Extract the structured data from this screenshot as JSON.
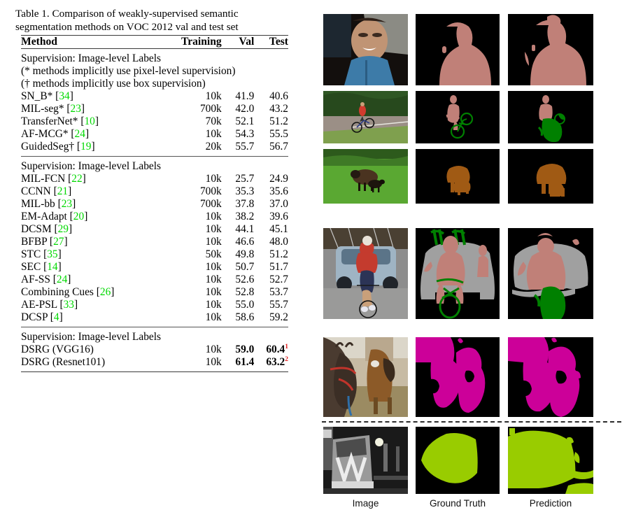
{
  "table": {
    "caption": "Table 1. Comparison of weakly-supervised semantic segmentation methods on VOC 2012 val and test set",
    "headers": {
      "method": "Method",
      "training": "Training",
      "val": "Val",
      "test": "Test"
    },
    "blocks": [
      {
        "group_label": "Supervision: Image-level Labels",
        "notes": [
          "(* methods implicitly use pixel-level supervision)",
          "(† methods implicitly use box supervision)"
        ],
        "rows": [
          {
            "method": "SN_B* [",
            "cite": "34",
            "close": "]",
            "training": "10k",
            "val": "41.9",
            "test": "40.6"
          },
          {
            "method": "MIL-seg* [",
            "cite": "23",
            "close": "]",
            "training": "700k",
            "val": "42.0",
            "test": "43.2"
          },
          {
            "method": "TransferNet* [",
            "cite": "10",
            "close": "]",
            "training": "70k",
            "val": "52.1",
            "test": "51.2"
          },
          {
            "method": "AF-MCG* [",
            "cite": "24",
            "close": "]",
            "training": "10k",
            "val": "54.3",
            "test": "55.5"
          },
          {
            "method": "GuidedSeg† [",
            "cite": "19",
            "close": "]",
            "training": "20k",
            "val": "55.7",
            "test": "56.7"
          }
        ]
      },
      {
        "group_label": "Supervision: Image-level Labels",
        "notes": [],
        "rows": [
          {
            "method": "MIL-FCN [",
            "cite": "22",
            "close": "]",
            "training": "10k",
            "val": "25.7",
            "test": "24.9"
          },
          {
            "method": "CCNN [",
            "cite": "21",
            "close": "]",
            "training": "700k",
            "val": "35.3",
            "test": "35.6"
          },
          {
            "method": "MIL-bb [",
            "cite": "23",
            "close": "]",
            "training": "700k",
            "val": "37.8",
            "test": "37.0"
          },
          {
            "method": "EM-Adapt [",
            "cite": "20",
            "close": "]",
            "training": "10k",
            "val": "38.2",
            "test": "39.6"
          },
          {
            "method": "DCSM [",
            "cite": "29",
            "close": "]",
            "training": "10k",
            "val": "44.1",
            "test": "45.1"
          },
          {
            "method": "BFBP [",
            "cite": "27",
            "close": "]",
            "training": "10k",
            "val": "46.6",
            "test": "48.0"
          },
          {
            "method": "STC [",
            "cite": "35",
            "close": "]",
            "training": "50k",
            "val": "49.8",
            "test": "51.2"
          },
          {
            "method": "SEC [",
            "cite": "14",
            "close": "]",
            "training": "10k",
            "val": "50.7",
            "test": "51.7"
          },
          {
            "method": "AF-SS [",
            "cite": "24",
            "close": "]",
            "training": "10k",
            "val": "52.6",
            "test": "52.7"
          },
          {
            "method": "Combining Cues [",
            "cite": "26",
            "close": "]",
            "training": "10k",
            "val": "52.8",
            "test": "53.7"
          },
          {
            "method": "AE-PSL [",
            "cite": "33",
            "close": "]",
            "training": "10k",
            "val": "55.0",
            "test": "55.7"
          },
          {
            "method": "DCSP [",
            "cite": "4",
            "close": "]",
            "training": "10k",
            "val": "58.6",
            "test": "59.2"
          }
        ]
      },
      {
        "group_label": "Supervision: Image-level Labels",
        "notes": [],
        "rows": [
          {
            "method": "DSRG (VGG16)",
            "cite": "",
            "close": "",
            "training": "10k",
            "val": "59.0",
            "test": "60.4",
            "test_sup": "1",
            "bold": true
          },
          {
            "method": "DSRG (Resnet101)",
            "cite": "",
            "close": "",
            "training": "10k",
            "val": "61.4",
            "test": "63.2",
            "test_sup": "2",
            "bold": true
          }
        ]
      }
    ]
  },
  "grid": {
    "column_labels": [
      "Image",
      "Ground Truth",
      "Prediction"
    ],
    "rows": [
      {
        "name": "person-portrait",
        "classes": [
          "person"
        ]
      },
      {
        "name": "person-bicycle-road",
        "classes": [
          "person",
          "bicycle"
        ]
      },
      {
        "name": "sheep-field",
        "classes": [
          "sheep"
        ]
      },
      {
        "name": "cyclist-car-crowd",
        "classes": [
          "person",
          "bicycle",
          "car"
        ]
      },
      {
        "name": "horses",
        "classes": [
          "horse"
        ]
      },
      {
        "name": "train-night",
        "classes": [
          "train"
        ]
      }
    ],
    "colors": {
      "background": "#000000",
      "person": "#c08078",
      "bicycle": "#008000",
      "sheep": "#a05a14",
      "car": "#a0a0a0",
      "horse": "#cc0099",
      "train": "#99cc00"
    }
  }
}
